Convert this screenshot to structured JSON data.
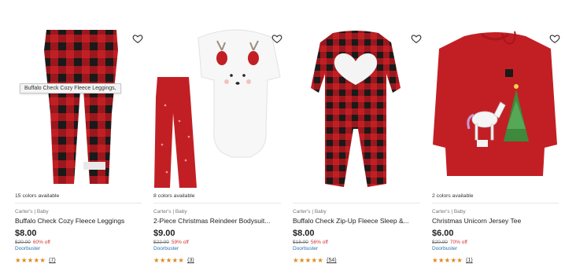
{
  "tooltip": "Buffalo Check Cozy Fleece Leggings,",
  "products": [
    {
      "colors": "15 colors available",
      "brand": "Carter's | Baby",
      "title": "Buffalo Check Cozy Fleece Leggings",
      "price": "$8.00",
      "old_price": "$20.00",
      "discount": "60% off",
      "tag": "Doorbuster",
      "stars": "★★★★★",
      "reviews": "(7)"
    },
    {
      "colors": "8 colors available",
      "brand": "Carter's | Baby",
      "title": "2-Piece Christmas Reindeer Bodysuit...",
      "price": "$9.00",
      "old_price": "$22.00",
      "discount": "59% off",
      "tag": "Doorbuster",
      "stars": "★★★★★",
      "reviews": "(3)"
    },
    {
      "colors": "",
      "brand": "Carter's | Baby",
      "title": "Buffalo Check Zip-Up Fleece Sleep &...",
      "price": "$8.00",
      "old_price": "$18.00",
      "discount": "56% off",
      "tag": "Doorbuster",
      "stars": "★★★★★",
      "reviews": "(54)"
    },
    {
      "colors": "2 colors available",
      "brand": "Carter's | Baby",
      "title": "Christmas Unicorn Jersey Tee",
      "price": "$6.00",
      "old_price": "$20.00",
      "discount": "70% off",
      "tag": "Doorbuster",
      "stars": "★★★★★",
      "reviews": "(1)"
    }
  ],
  "colors": {
    "red": "#c21f25",
    "black": "#1a1a1a",
    "star": "#e08a1e",
    "link": "#2c6fb7",
    "discount": "#d23131"
  }
}
